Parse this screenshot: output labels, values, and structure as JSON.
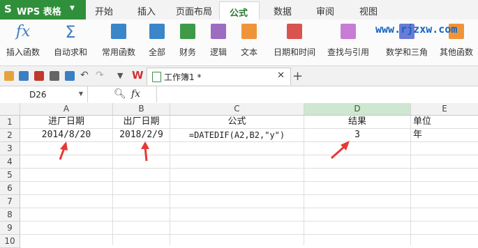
{
  "app": {
    "name": "WPS 表格"
  },
  "menu_tabs": [
    "开始",
    "插入",
    "页面布局",
    "公式",
    "数据",
    "审阅",
    "视图"
  ],
  "ribbon": {
    "buttons": [
      "插入函数",
      "自动求和",
      "常用函数",
      "全部",
      "财务",
      "逻辑",
      "文本",
      "日期和时间",
      "查找与引用",
      "数学和三角",
      "其他函数"
    ]
  },
  "watermark": "www.rjzxw.com",
  "document_tab": {
    "title": "工作簿1 *"
  },
  "formula_bar": {
    "name_box": "D26",
    "fx_label": "fx",
    "content": ""
  },
  "sheet": {
    "columns": [
      "A",
      "B",
      "C",
      "D",
      "E"
    ],
    "selected_column": "D",
    "row_numbers": [
      "1",
      "2",
      "3",
      "4",
      "5",
      "6",
      "7",
      "8",
      "9",
      "10"
    ],
    "rows": [
      [
        "进厂日期",
        "出厂日期",
        "公式",
        "结果",
        "单位"
      ],
      [
        "2014/8/20",
        "2018/2/9",
        "=DATEDIF(A2,B2,\"y\")",
        "3",
        "年"
      ]
    ]
  },
  "colors": {
    "accent_green": "#2f8f3a",
    "arrow_red": "#e53935",
    "watermark_blue": "#1565c0"
  }
}
